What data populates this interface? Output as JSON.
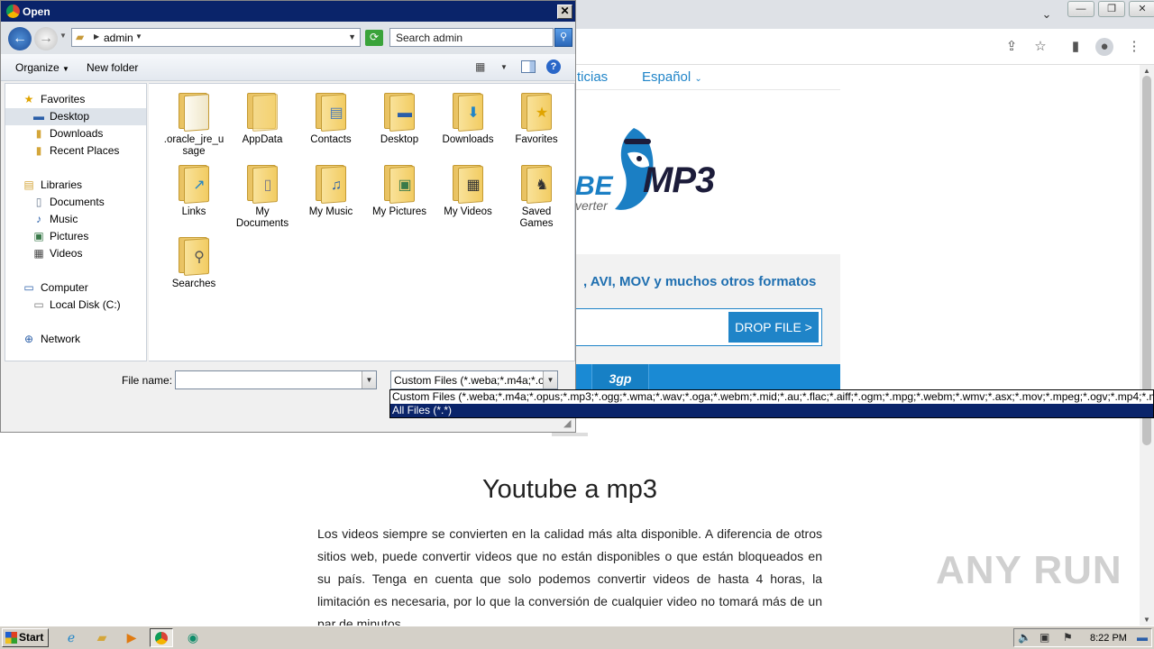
{
  "browser": {
    "nav": {
      "noticias": "ticias",
      "espanol": "Español"
    },
    "logo": {
      "part1": "BE",
      "part2": "MP3",
      "part3": "verter"
    },
    "hero_text": ", AVI, MOV y muchos otros formatos",
    "drop_button": "DROP FILE >",
    "format_3gp": "3gp",
    "article_title": "Youtube a mp3",
    "article_body": "Los videos siempre se convierten en la calidad más alta disponible. A diferencia de otros sitios web, puede convertir videos que no están disponibles o que están bloqueados en su país. Tenga en cuenta que solo podemos convertir videos de hasta 4 horas, la limitación es necesaria, por lo que la conversión de cualquier video no tomará más de un par de minutos.",
    "watermark": "ANY RUN"
  },
  "dialog": {
    "title": "Open",
    "address": "admin",
    "search_placeholder": "Search admin",
    "organize": "Organize",
    "new_folder": "New folder",
    "nav_items": [
      {
        "label": "Favorites",
        "icon": "star-icon"
      },
      {
        "label": "Desktop",
        "icon": "desktop-icon"
      },
      {
        "label": "Downloads",
        "icon": "downloads-icon"
      },
      {
        "label": "Recent Places",
        "icon": "recent-places-icon"
      },
      {
        "label": "Libraries",
        "icon": "libraries-icon"
      },
      {
        "label": "Documents",
        "icon": "documents-icon"
      },
      {
        "label": "Music",
        "icon": "music-icon"
      },
      {
        "label": "Pictures",
        "icon": "pictures-icon"
      },
      {
        "label": "Videos",
        "icon": "videos-icon"
      },
      {
        "label": "Computer",
        "icon": "computer-icon"
      },
      {
        "label": "Local Disk (C:)",
        "icon": "disk-icon"
      },
      {
        "label": "Network",
        "icon": "network-icon"
      }
    ],
    "files": [
      {
        "label": ".oracle_jre_usage"
      },
      {
        "label": "AppData"
      },
      {
        "label": "Contacts"
      },
      {
        "label": "Desktop"
      },
      {
        "label": "Downloads"
      },
      {
        "label": "Favorites"
      },
      {
        "label": "Links"
      },
      {
        "label": "My Documents"
      },
      {
        "label": "My Music"
      },
      {
        "label": "My Pictures"
      },
      {
        "label": "My Videos"
      },
      {
        "label": "Saved Games"
      },
      {
        "label": "Searches"
      }
    ],
    "file_name_label": "File name:",
    "file_name_value": "",
    "file_type_selected": "Custom Files (*.weba;*.m4a;*.opus;*.mp3;*.ogg;*.wma;*.wav;*.oga;*.webm;*.mid;*.au;*.flac;*.aiff;*.ogm;*.mpg;*.webm;*.wmv;*.asx;*.mov;*.mpeg;*.ogv;*.mp4;*.m",
    "file_type_options": [
      "Custom Files (*.weba;*.m4a;*.opus;*.mp3;*.ogg;*.wma;*.wav;*.oga;*.webm;*.mid;*.au;*.flac;*.aiff;*.ogm;*.mpg;*.webm;*.wmv;*.asx;*.mov;*.mpeg;*.ogv;*.mp4;*.m",
      "All Files (*.*)"
    ]
  },
  "taskbar": {
    "start": "Start",
    "clock": "8:22 PM"
  },
  "colors": {
    "accent": "#1f84c8",
    "selection": "#0a246a",
    "folder": "#f2cc62"
  }
}
